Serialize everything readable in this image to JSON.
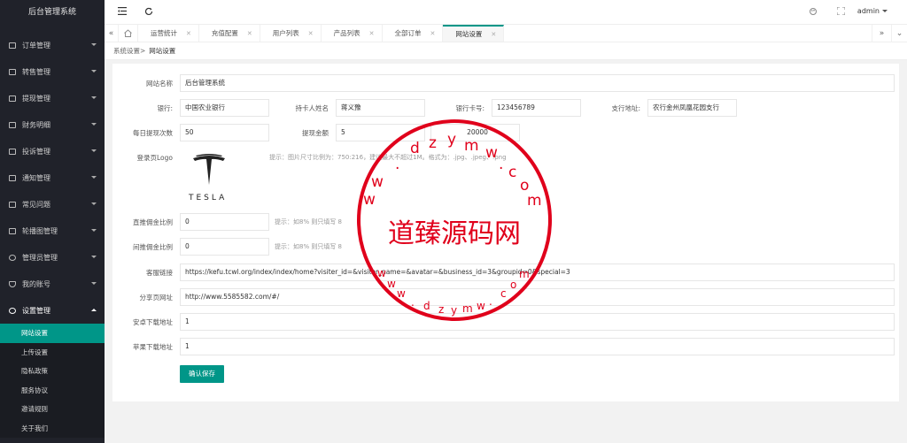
{
  "app": {
    "title": "后台管理系统"
  },
  "sidebar": {
    "items": [
      {
        "label": "订单管理",
        "icon": "list-icon"
      },
      {
        "label": "转售管理",
        "icon": "list-icon"
      },
      {
        "label": "提现管理",
        "icon": "list-icon"
      },
      {
        "label": "财务明细",
        "icon": "list-icon"
      },
      {
        "label": "投诉管理",
        "icon": "list-icon"
      },
      {
        "label": "通知管理",
        "icon": "list-icon"
      },
      {
        "label": "常见问题",
        "icon": "list-icon"
      },
      {
        "label": "轮播图管理",
        "icon": "list-icon"
      },
      {
        "label": "管理员管理",
        "icon": "user-icon"
      },
      {
        "label": "我的账号",
        "icon": "shield-icon"
      },
      {
        "label": "设置管理",
        "icon": "gear-icon"
      }
    ],
    "submenu": [
      {
        "label": "网站设置",
        "active": true
      },
      {
        "label": "上传设置"
      },
      {
        "label": "隐私政策"
      },
      {
        "label": "服务协议"
      },
      {
        "label": "邀请规则"
      },
      {
        "label": "关于我们"
      }
    ]
  },
  "topbar": {
    "user": "admin"
  },
  "tabs": [
    {
      "label": "运营统计"
    },
    {
      "label": "充值配置"
    },
    {
      "label": "用户列表"
    },
    {
      "label": "产品列表"
    },
    {
      "label": "全部订单"
    },
    {
      "label": "网站设置",
      "active": true
    }
  ],
  "breadcrumb": {
    "parent": "系统设置>",
    "current": "网站设置"
  },
  "form": {
    "site_name": {
      "label": "网站名称",
      "value": "后台管理系统"
    },
    "bank": {
      "label": "银行:",
      "value": "中国农业银行"
    },
    "holder": {
      "label": "持卡人姓名",
      "value": "蒋义豫"
    },
    "card_no": {
      "label": "银行卡号:",
      "value": "123456789"
    },
    "branch": {
      "label": "支行地址:",
      "value": "农行金州凤凰花园支行"
    },
    "daily_times": {
      "label": "每日提现次数",
      "value": "50"
    },
    "withdraw_amount": {
      "label": "提现金额",
      "value": "5",
      "max": "20000"
    },
    "logo": {
      "label": "登录页Logo",
      "hint": "提示：图片尺寸比例为：750:216，建议最大不超过1M。格式为：.jpg、.jpeg、.png",
      "brand_text": "TESLA"
    },
    "direct_commission": {
      "label": "直推佣金比例",
      "value": "0",
      "hint": "提示：如8% 则只填写 8"
    },
    "indirect_commission": {
      "label": "间推佣金比例",
      "value": "0",
      "hint": "提示：如8% 则只填写 8"
    },
    "service_link": {
      "label": "客服链接",
      "value": "https://kefu.tcwl.org/index/index/home?visiter_id=&visiter_name=&avatar=&business_id=3&groupid=0&special=3"
    },
    "share_url": {
      "label": "分享页网址",
      "value": "http://www.5585582.com/#/"
    },
    "android_url": {
      "label": "安卓下载地址",
      "value": "1"
    },
    "ios_url": {
      "label": "苹果下载地址",
      "value": "1"
    },
    "save_label": "确认保存"
  },
  "watermark": {
    "center_text": "道臻源码网",
    "arc_text": "www.dzym.com"
  },
  "colors": {
    "accent": "#009688",
    "sidebar_bg": "#20222a",
    "stamp": "#e0001b"
  }
}
